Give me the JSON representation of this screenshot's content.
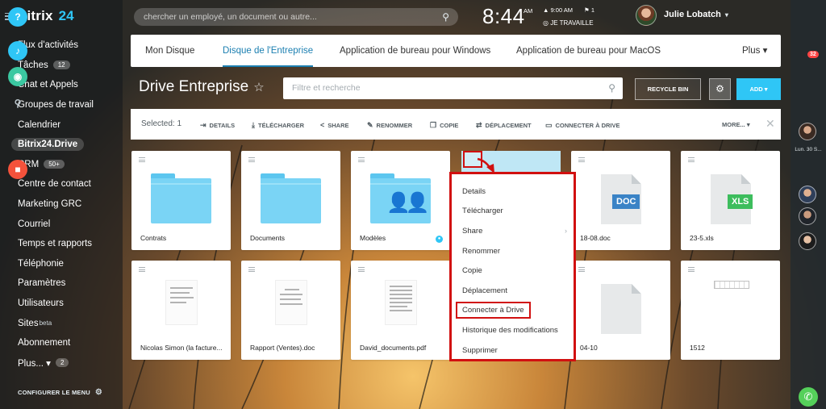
{
  "app": {
    "logo": "Bitrix",
    "logo_accent": "24"
  },
  "sidebar": {
    "items": [
      {
        "label": "Flux d'activités"
      },
      {
        "label": "Tâches",
        "badge": "12"
      },
      {
        "label": "Chat et Appels"
      },
      {
        "label": "Groupes de travail"
      },
      {
        "label": "Calendrier"
      },
      {
        "label": "Bitrix24.Drive",
        "active": true
      },
      {
        "label": "CRM",
        "badge": "50+"
      },
      {
        "label": "Centre de contact"
      },
      {
        "label": "Marketing GRC"
      },
      {
        "label": "Courriel"
      },
      {
        "label": "Temps et rapports"
      },
      {
        "label": "Téléphonie"
      },
      {
        "label": "Paramètres"
      },
      {
        "label": "Utilisateurs"
      },
      {
        "label": "Sites",
        "sup": "beta"
      },
      {
        "label": "Abonnement"
      },
      {
        "label": "Plus... ▾",
        "badge": "2"
      }
    ],
    "configure": "CONFIGURER LE MENU"
  },
  "header": {
    "search_placeholder": "chercher un employé, un document ou autre...",
    "time": "8:44",
    "ampm": "AM",
    "alarm": "9:00 AM",
    "flag_count": "1",
    "work_status": "JE TRAVAILLE",
    "user_name": "Julie Lobatch"
  },
  "right_rail": {
    "help": "?",
    "notif_count": "32",
    "user_label": "Lun. 30 S..."
  },
  "tabs": [
    "Mon Disque",
    "Disque de l'Entreprise",
    "Application de bureau pour Windows",
    "Application de bureau pour MacOS",
    "Plus ▾"
  ],
  "title_row": {
    "title": "Drive Entreprise",
    "filter_placeholder": "Filtre et recherche",
    "recycle": "RECYCLE BIN",
    "add": "ADD ▾"
  },
  "toolbar": {
    "selected": "Selected: 1",
    "actions": [
      "DETAILS",
      "TÉLÉCHARGER",
      "SHARE",
      "RENOMMER",
      "COPIE",
      "DÉPLACEMENT",
      "CONNECTER À DRIVE"
    ],
    "more": "MORE... ▾"
  },
  "files": [
    {
      "name": "Contrats",
      "kind": "folder"
    },
    {
      "name": "Documents",
      "kind": "folder"
    },
    {
      "name": "Modèles",
      "kind": "shared-folder"
    },
    {
      "name": "18-08.doc",
      "kind": "doc",
      "badge": "DOC",
      "badge_color": "#3a83c6"
    },
    {
      "name": "23-5.xls",
      "kind": "xls",
      "badge": "XLS",
      "badge_color": "#3dbd5d"
    },
    {
      "name": "Nicolas Simon (la facture...",
      "kind": "scan"
    },
    {
      "name": "Rapport (Ventes).doc",
      "kind": "scan"
    },
    {
      "name": "David_documents.pdf",
      "kind": "scan"
    },
    {
      "name": "04-10",
      "kind": "file"
    },
    {
      "name": "1512",
      "kind": "table"
    }
  ],
  "context_menu": {
    "items": [
      "Details",
      "Télécharger",
      "Share",
      "Renommer",
      "Copie",
      "Déplacement",
      "Connecter à Drive",
      "Historique des modifications",
      "Supprimer"
    ],
    "highlighted": "Connecter à Drive"
  },
  "colors": {
    "accent": "#2fc6f6",
    "link": "#1b7fb1",
    "highlight": "#d11010"
  }
}
